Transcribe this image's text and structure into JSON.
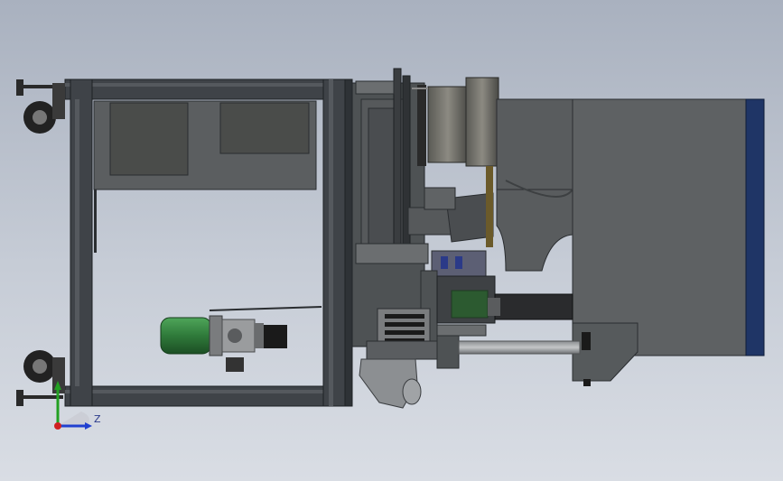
{
  "viewport": {
    "background_top": "#a9b1bf",
    "background_bottom": "#d9dde4"
  },
  "triad": {
    "z_label": "Z"
  },
  "colors": {
    "frame": "#3f4348",
    "frame_dark": "#2e3236",
    "panel": "#5b5e60",
    "housing": "#4e5254",
    "hood": "#595c5e",
    "hood_trim": "#1f3566",
    "motor": "#2f7a3a",
    "glass": "#1a1a1a",
    "axis_x": "#d02020",
    "axis_y": "#22a022",
    "axis_z": "#2040d0"
  },
  "icons": [
    "caster-wheel-icon",
    "leveling-foot-icon",
    "coordinate-triad-icon"
  ]
}
